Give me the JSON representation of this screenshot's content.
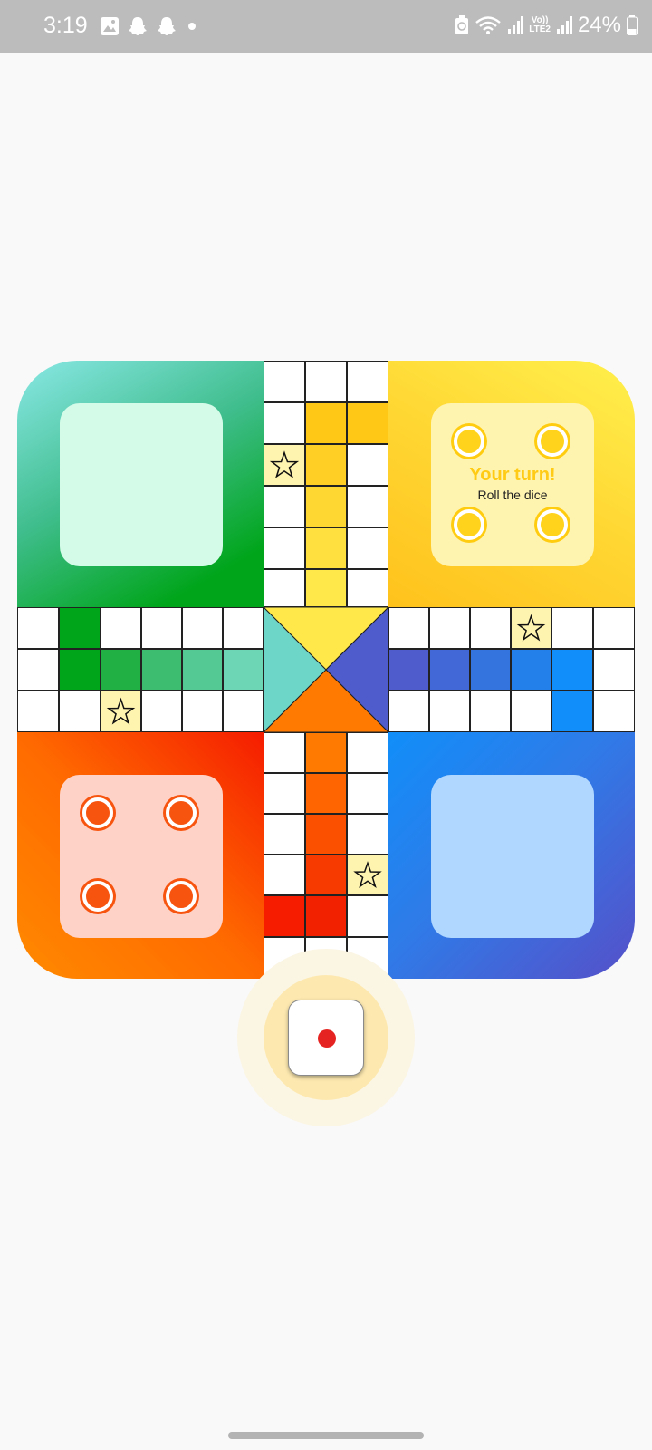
{
  "status_bar": {
    "time": "3:19",
    "notification_icons": [
      "gallery-icon",
      "snapchat-icon",
      "snapchat-icon",
      "dot-icon"
    ],
    "right_icons": [
      "battery-saver-icon",
      "wifi-icon",
      "signal-icon",
      "volte-icon",
      "signal-icon"
    ],
    "volte_top": "Vo))",
    "volte_bottom": "LTE2",
    "battery": "24%"
  },
  "board": {
    "colors": {
      "green": "#00a51a",
      "yellow": "#ffd21c",
      "orange": "#ff6a00",
      "red": "#f51c00",
      "blue": "#2f7be8",
      "cyan": "#8ae8e6",
      "purple": "#5650c8"
    },
    "yellow_yard": {
      "turn_title": "Your turn!",
      "turn_subtitle": "Roll the dice",
      "tokens_in_home": 4
    },
    "orange_yard": {
      "tokens_in_home": 4
    },
    "green_yard": {
      "tokens_in_home": 0
    },
    "blue_yard": {
      "tokens_in_home": 0
    },
    "safe_star_icon": "star-outline-icon"
  },
  "dice": {
    "value": 1,
    "state": "ready-to-roll"
  }
}
